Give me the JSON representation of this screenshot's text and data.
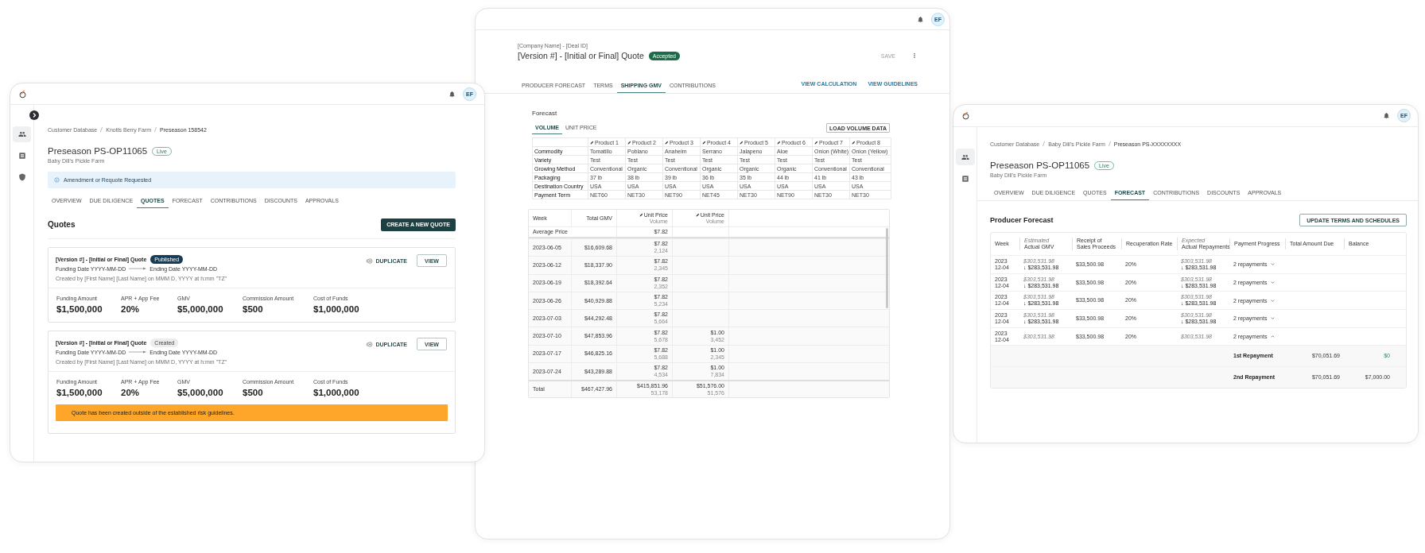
{
  "quotes_window": {
    "avatar": "EF",
    "sidebar": [
      {
        "selected": true
      },
      {
        "selected": false
      },
      {
        "selected": false
      }
    ],
    "breadcrumbs": [
      "Customer Database",
      "Knotts Berry Farm",
      "Preseason 158542"
    ],
    "title": "Preseason PS-OP11065",
    "status": {
      "label": "Live",
      "kind": "live"
    },
    "subtitle": "Baby Dill’s Pickle Farm",
    "banner": "Amendment or Requote Requested",
    "tabs": [
      {
        "label": "OVERVIEW",
        "selected": false
      },
      {
        "label": "DUE DILIGENCE",
        "selected": false
      },
      {
        "label": "QUOTES",
        "selected": true
      },
      {
        "label": "FORECAST",
        "selected": false
      },
      {
        "label": "CONTRIBUTIONS",
        "selected": false
      },
      {
        "label": "DISCOUNTS",
        "selected": false
      },
      {
        "label": "APPROVALS",
        "selected": false
      }
    ],
    "section_title": "Quotes",
    "create_button": "CREATE A NEW QUOTE",
    "quotes": [
      {
        "title": "[Version #] - [Initial or Final] Quote",
        "status": {
          "label": "Published",
          "kind": "published"
        },
        "funding_date": "Funding Date YYYY-MM-DD",
        "ending_date": "Ending Date YYYY-MM-DD",
        "created_by": "Created by [First Name] [Last Name] on MMM D, YYYY at h:mm \"TZ\"",
        "duplicate_button": "DUPLICATE",
        "view_button": "VIEW",
        "metrics": [
          {
            "label": "Funding Amount",
            "value": "$1,500,000"
          },
          {
            "label": "APR + App Fee",
            "value": "20%"
          },
          {
            "label": "GMV",
            "value": "$5,000,000"
          },
          {
            "label": "Commission Amount",
            "value": "$500"
          },
          {
            "label": "Cost of Funds",
            "value": "$1,000,000"
          }
        ]
      },
      {
        "title": "[Version #] - [Initial or Final] Quote",
        "status": {
          "label": "Created",
          "kind": "created"
        },
        "funding_date": "Funding Date YYYY-MM-DD",
        "ending_date": "Ending Date YYYY-MM-DD",
        "created_by": "Created by [First Name] [Last Name] on MMM D, YYYY at h:mm \"TZ\"",
        "duplicate_button": "DUPLICATE",
        "view_button": "VIEW",
        "metrics": [
          {
            "label": "Funding Amount",
            "value": "$1,500,000"
          },
          {
            "label": "APR + App Fee",
            "value": "20%"
          },
          {
            "label": "GMV",
            "value": "$5,000,000"
          },
          {
            "label": "Commission Amount",
            "value": "$500"
          },
          {
            "label": "Cost of Funds",
            "value": "$1,000,000"
          }
        ],
        "warning": "Quote has been created outside of the established risk guidelines."
      }
    ]
  },
  "shipping_gmv_window": {
    "avatar": "EF",
    "breadcrumb": "[Company Name] - [Deal ID]",
    "title": "[Version #] - [Initial or Final] Quote",
    "status": {
      "label": "Accepted",
      "kind": "accepted"
    },
    "save_button": {
      "label": "SAVE",
      "disabled": true
    },
    "tabs": [
      {
        "label": "PRODUCER FORECAST",
        "selected": false
      },
      {
        "label": "TERMS",
        "selected": false
      },
      {
        "label": "SHIPPING GMV",
        "selected": true
      },
      {
        "label": "CONTRIBUTIONS",
        "selected": false
      }
    ],
    "links": [
      "VIEW CALCULATION",
      "VIEW GUIDELINES"
    ],
    "forecast_title": "Forecast",
    "subtabs": [
      {
        "label": "VOLUME",
        "selected": true
      },
      {
        "label": "UNIT PRICE",
        "selected": false
      }
    ],
    "load_button": "LOAD VOLUME DATA",
    "products_table": {
      "columns": [
        "Product 1",
        "Product 2",
        "Product 3",
        "Product 4",
        "Product 5",
        "Product 6",
        "Product 7",
        "Product 8"
      ],
      "rows": [
        {
          "label": "Commodity",
          "cells": [
            "Tomatillo",
            "Poblano",
            "Anaheim",
            "Serrano",
            "Jalapeno",
            "Aloe",
            "Onion (White)",
            "Onion (Yellow)"
          ]
        },
        {
          "label": "Variety",
          "cells": [
            "Test",
            "Test",
            "Test",
            "Test",
            "Test",
            "Test",
            "Test",
            "Test"
          ]
        },
        {
          "label": "Growing Method",
          "cells": [
            "Conventional",
            "Organic",
            "Conventional",
            "Organic",
            "Organic",
            "Organic",
            "Conventional",
            "Conventional"
          ]
        },
        {
          "label": "Packaging",
          "cells": [
            "37 lb",
            "38 lb",
            "39 lb",
            "36 lb",
            "35 lb",
            "44 lb",
            "41 lb",
            "43 lb"
          ]
        },
        {
          "label": "Destination Country",
          "cells": [
            "USA",
            "USA",
            "USA",
            "USA",
            "USA",
            "USA",
            "USA",
            "USA"
          ]
        },
        {
          "label": "Payment Term",
          "cells": [
            "NET60",
            "NET30",
            "NET90",
            "NET45",
            "NET30",
            "NET90",
            "NET30",
            "NET30"
          ]
        }
      ]
    },
    "gmv_table": {
      "columns": [
        {
          "label": "Week"
        },
        {
          "label": "Total GMV"
        },
        {
          "label": "Unit Price",
          "sublabel": "Volume"
        },
        {
          "label": "Unit Price",
          "sublabel": "Volume"
        }
      ],
      "average_row": {
        "label": "Average Price",
        "prices": [
          "$7.82"
        ]
      },
      "rows": [
        {
          "week": "2023-06-05",
          "total_gmv": "$16,609.68",
          "products": [
            {
              "price": "$7.82",
              "volume": "2,124"
            }
          ]
        },
        {
          "week": "2023-06-12",
          "total_gmv": "$18,337.90",
          "products": [
            {
              "price": "$7.82",
              "volume": "2,345"
            }
          ]
        },
        {
          "week": "2023-06-19",
          "total_gmv": "$18,392.64",
          "products": [
            {
              "price": "$7.82",
              "volume": "2,352"
            }
          ]
        },
        {
          "week": "2023-06-26",
          "total_gmv": "$40,929.88",
          "products": [
            {
              "price": "$7.82",
              "volume": "5,234"
            }
          ]
        },
        {
          "week": "2023-07-03",
          "total_gmv": "$44,292.48",
          "products": [
            {
              "price": "$7.82",
              "volume": "5,664"
            }
          ]
        },
        {
          "week": "2023-07-10",
          "total_gmv": "$47,853.96",
          "products": [
            {
              "price": "$7.82",
              "volume": "5,678"
            },
            {
              "price": "$1.00",
              "volume": "3,452"
            }
          ]
        },
        {
          "week": "2023-07-17",
          "total_gmv": "$46,825.16",
          "products": [
            {
              "price": "$7.82",
              "volume": "5,688"
            },
            {
              "price": "$1.00",
              "volume": "2,345"
            }
          ]
        },
        {
          "week": "2023-07-24",
          "total_gmv": "$43,289.88",
          "products": [
            {
              "price": "$7.82",
              "volume": "4,534"
            },
            {
              "price": "$1.00",
              "volume": "7,834"
            }
          ]
        }
      ],
      "total_row": {
        "label": "Total",
        "total_gmv": "$467,427.96",
        "products": [
          {
            "price": "$415,851.96",
            "volume": "53,178"
          },
          {
            "price": "$51,576.00",
            "volume": "51,576"
          }
        ]
      }
    }
  },
  "forecast_window": {
    "avatar": "EF",
    "sidebar": [
      {
        "selected": true
      },
      {
        "selected": false
      }
    ],
    "breadcrumbs": [
      "Customer Database",
      "Baby Dill’s Pickle Farm",
      "Preseason PS-XXXXXXXX"
    ],
    "title": "Preseason PS-OP11065",
    "status": {
      "label": "Live",
      "kind": "live"
    },
    "subtitle": "Baby Dill’s Pickle Farm",
    "tabs": [
      {
        "label": "OVERVIEW",
        "selected": false
      },
      {
        "label": "DUE DILIGENCE",
        "selected": false
      },
      {
        "label": "QUOTES",
        "selected": false
      },
      {
        "label": "FORECAST",
        "selected": true
      },
      {
        "label": "CONTRIBUTIONS",
        "selected": false
      },
      {
        "label": "DISCOUNTS",
        "selected": false
      },
      {
        "label": "APPROVALS",
        "selected": false
      }
    ],
    "section_title": "Producer Forecast",
    "update_button": "UPDATE TERMS AND SCHEDULES",
    "table": {
      "columns": [
        {
          "label": "Week"
        },
        {
          "caption": "Estimated",
          "label": "Actual GMV"
        },
        {
          "label": "Receipt of Sales Proceeds"
        },
        {
          "label": "Recuperation Rate"
        },
        {
          "caption": "Expected",
          "label": "Actual Repayments"
        },
        {
          "label": "Payment Progress"
        },
        {
          "label": "Total Amount Due"
        },
        {
          "label": "Balance"
        }
      ],
      "rows": [
        {
          "week": "2023 12-04",
          "estimated_gmv": "$303,531.98",
          "actual_gmv": "↓ $283,531.98",
          "sales_proceeds": "$33,500.98",
          "recuperation_rate": "20%",
          "expected_repayment": "$303,531.98",
          "actual_repayment": "↓ $283,531.98",
          "payment_progress": "2 repayments",
          "expanded": false
        },
        {
          "week": "2023 12-04",
          "estimated_gmv": "$303,531.98",
          "actual_gmv": "↓ $283,531.98",
          "sales_proceeds": "$33,500.98",
          "recuperation_rate": "20%",
          "expected_repayment": "$303,531.98",
          "actual_repayment": "↓ $283,531.98",
          "payment_progress": "2 repayments",
          "expanded": false
        },
        {
          "week": "2023 12-04",
          "estimated_gmv": "$303,531.98",
          "actual_gmv": "↓ $283,531.98",
          "sales_proceeds": "$33,500.98",
          "recuperation_rate": "20%",
          "expected_repayment": "$303,531.98",
          "actual_repayment": "↓ $283,531.98",
          "payment_progress": "2 repayments",
          "expanded": false
        },
        {
          "week": "2023 12-04",
          "estimated_gmv": "$303,531.98",
          "actual_gmv": "↓ $283,531.98",
          "sales_proceeds": "$33,500.98",
          "recuperation_rate": "20%",
          "expected_repayment": "$303,531.98",
          "actual_repayment": "↓ $283,531.98",
          "payment_progress": "2 repayments",
          "expanded": false
        },
        {
          "week": "2023 12-04",
          "estimated_gmv": "$303,531.98",
          "sales_proceeds": "$33,500.98",
          "recuperation_rate": "20%",
          "expected_repayment": "$303,531.98",
          "payment_progress": "2 repayments",
          "expanded": true,
          "repayments": [
            {
              "label": "1st Repayment",
              "amount_due": "$70,051.69",
              "balance": "$0",
              "paid": true
            },
            {
              "label": "2nd Repayment",
              "amount_due": "$70,051.69",
              "balance": "$7,000.00",
              "paid": false
            }
          ]
        }
      ]
    }
  }
}
